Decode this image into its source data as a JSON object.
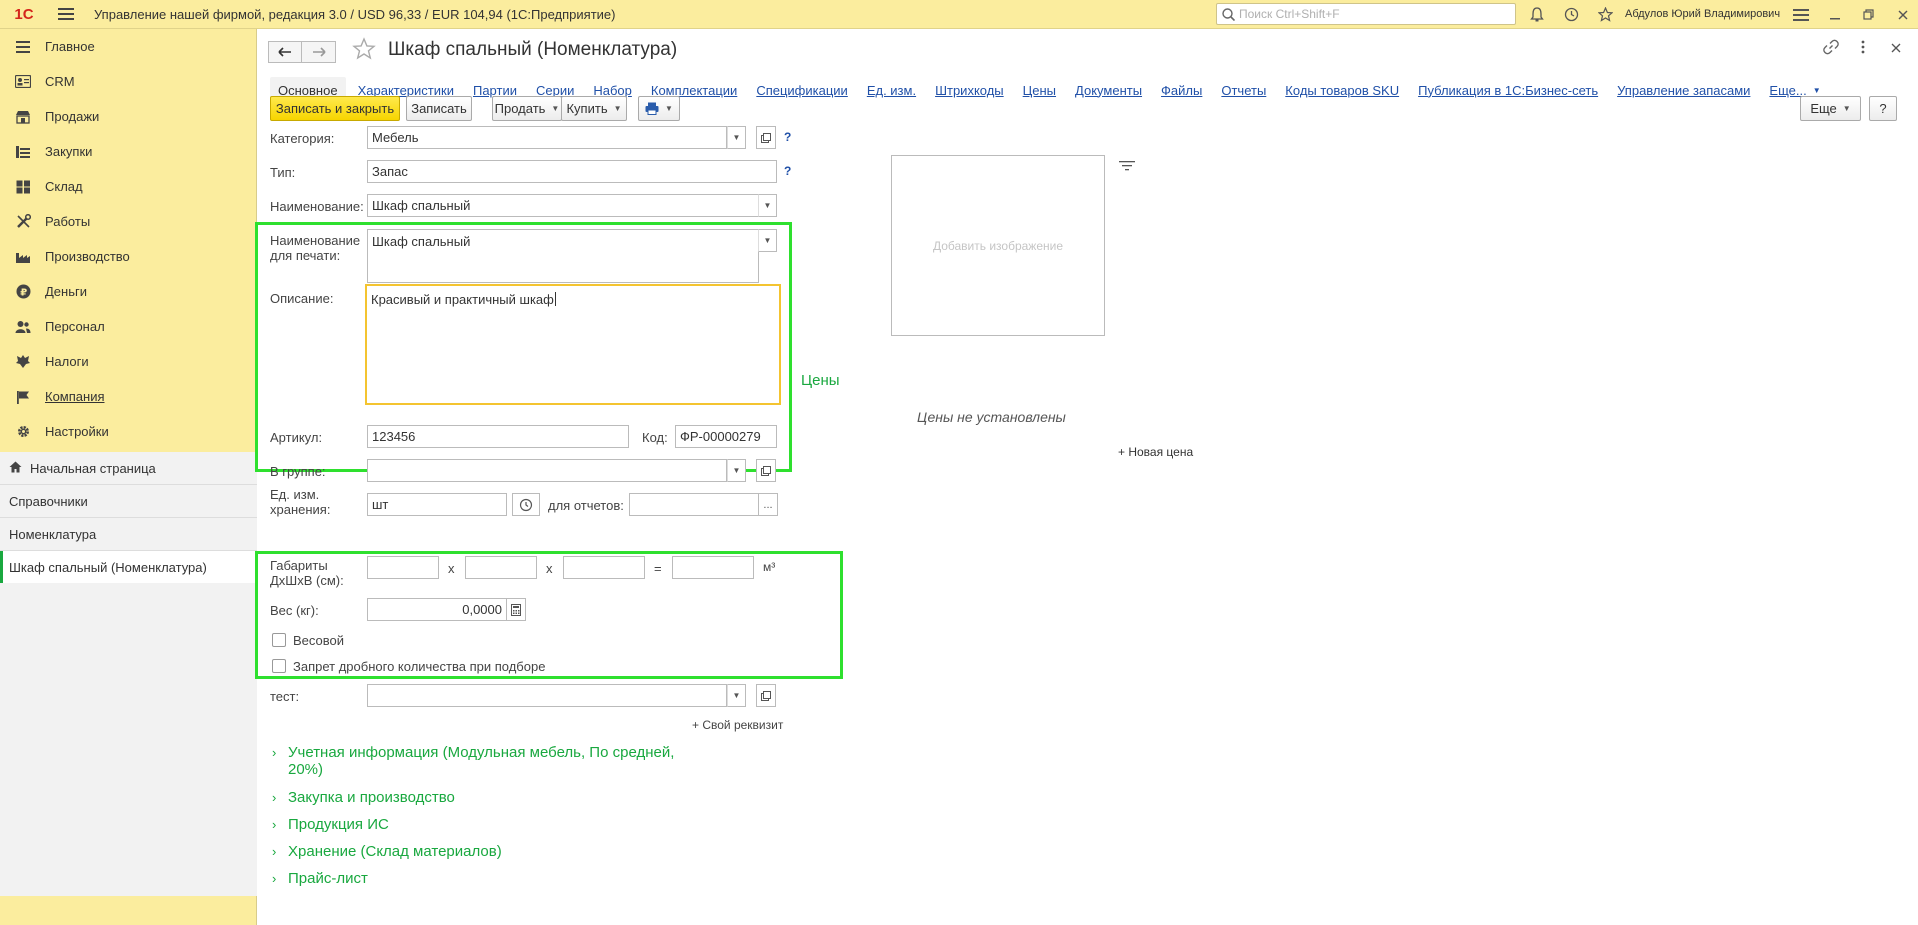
{
  "topbar": {
    "logo": "1С",
    "title": "Управление нашей фирмой, редакция 3.0 / USD 96,33 / EUR 104,94  (1С:Предприятие)",
    "search_placeholder": "Поиск Ctrl+Shift+F",
    "user": "Абдулов Юрий Владимирович"
  },
  "sidebar": {
    "items": [
      {
        "label": "Главное",
        "icon": "menu-lines-icon"
      },
      {
        "label": "CRM",
        "icon": "contacts-icon"
      },
      {
        "label": "Продажи",
        "icon": "shop-icon"
      },
      {
        "label": "Закупки",
        "icon": "cart-icon"
      },
      {
        "label": "Склад",
        "icon": "warehouse-icon"
      },
      {
        "label": "Работы",
        "icon": "tools-icon"
      },
      {
        "label": "Производство",
        "icon": "factory-icon"
      },
      {
        "label": "Деньги",
        "icon": "ruble-icon"
      },
      {
        "label": "Персонал",
        "icon": "people-icon"
      },
      {
        "label": "Налоги",
        "icon": "emblem-icon"
      },
      {
        "label": "Компания",
        "icon": "flag-icon"
      },
      {
        "label": "Настройки",
        "icon": "gear-icon"
      }
    ],
    "open_windows": [
      {
        "label": "Начальная страница"
      },
      {
        "label": "Справочники"
      },
      {
        "label": "Номенклатура"
      },
      {
        "label": "Шкаф спальный (Номенклатура)"
      }
    ]
  },
  "document": {
    "title": "Шкаф спальный (Номенклатура)",
    "tabs": [
      "Основное",
      "Характеристики",
      "Партии",
      "Серии",
      "Набор",
      "Комплектации",
      "Спецификации",
      "Ед. изм.",
      "Штрихкоды",
      "Цены",
      "Документы",
      "Файлы",
      "Отчеты",
      "Коды товаров SKU",
      "Публикация в 1С:Бизнес-сеть",
      "Управление запасами",
      "Еще..."
    ],
    "toolbar": {
      "save_close": "Записать и закрыть",
      "save": "Записать",
      "sell": "Продать",
      "buy": "Купить",
      "more": "Еще",
      "help": "?"
    }
  },
  "form": {
    "category_label": "Категория:",
    "category_value": "Мебель",
    "type_label": "Тип:",
    "type_value": "Запас",
    "name_label": "Наименование:",
    "name_value": "Шкаф спальный",
    "print_name_label": "Наименование для печати:",
    "print_name_value": "Шкаф спальный",
    "description_label": "Описание:",
    "description_value": "Красивый и практичный шкаф",
    "sku_label": "Артикул:",
    "sku_value": "123456",
    "code_label": "Код:",
    "code_value": "ФР-00000279",
    "group_label": "В группе:",
    "unit_label": "Ед. изм. хранения:",
    "unit_value": "шт",
    "report_label": "для отчетов:",
    "dims_label": "Габариты ДхШхВ (см):",
    "x_sign": "x",
    "eq_sign": "=",
    "m3": "м³",
    "weight_label": "Вес (кг):",
    "weight_value": "0,0000",
    "weighted_label": "Весовой",
    "fraction_ban_label": "Запрет дробного количества при подборе",
    "test_label": "тест:",
    "own_attr": "+ Свой реквизит",
    "help_mark": "?"
  },
  "side": {
    "add_image": "Добавить изображение",
    "prices_title": "Цены",
    "prices_empty": "Цены не установлены",
    "new_price": "+ Новая цена"
  },
  "sections": [
    {
      "line1": "Учетная информация (Модульная мебель, По средней,",
      "line2": "20%)"
    },
    {
      "line1": "Закупка и производство"
    },
    {
      "line1": "Продукция ИС"
    },
    {
      "line1": "Хранение (Склад материалов)"
    },
    {
      "line1": "Прайс-лист"
    }
  ],
  "colors": {
    "accent_green": "#19a83f",
    "frame_green": "#2ee02e",
    "primary_yellow": "#f7d500",
    "link_blue": "#2050a8"
  }
}
